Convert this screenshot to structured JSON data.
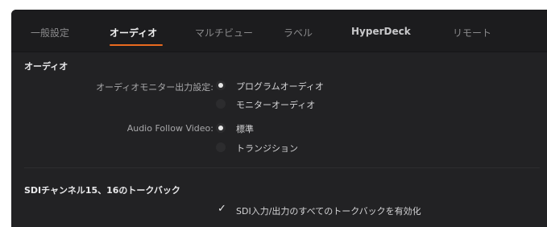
{
  "tabs": [
    {
      "label": "一般設定",
      "active": false
    },
    {
      "label": "オーディオ",
      "active": true
    },
    {
      "label": "マルチビュー",
      "active": false
    },
    {
      "label": "ラベル",
      "active": false
    },
    {
      "label": "HyperDeck",
      "active": false
    },
    {
      "label": "リモート",
      "active": false
    }
  ],
  "colors": {
    "accent": "#e96a1f",
    "panel": "#222224",
    "tabbar": "#1c1c1e"
  },
  "audio": {
    "section_title": "オーディオ",
    "monitor_output": {
      "label": "オーディオモニター出力設定:",
      "options": [
        "プログラムオーディオ",
        "モニターオーディオ"
      ],
      "selected": "プログラムオーディオ"
    },
    "audio_follow_video": {
      "label": "Audio Follow Video:",
      "options": [
        "標準",
        "トランジション"
      ],
      "selected": "標準"
    }
  },
  "talkback": {
    "section_title": "SDIチャンネル15、16のトークバック",
    "checkbox_label": "SDI入力/出力のすべてのトークバックを有効化",
    "checked": true,
    "check_icon": "checkmark-icon"
  }
}
